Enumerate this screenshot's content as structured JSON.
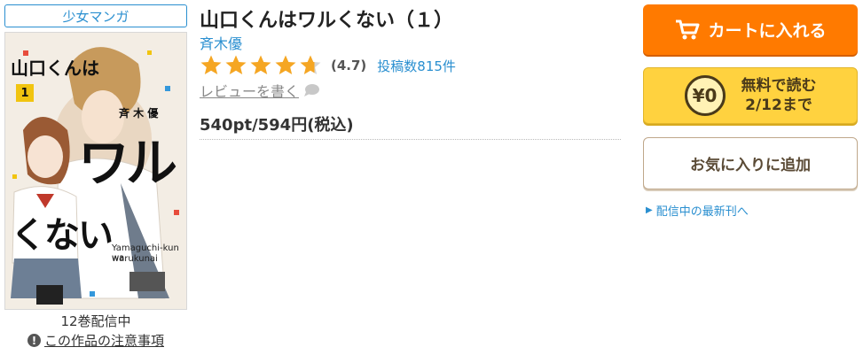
{
  "genre": "少女マンガ",
  "cover": {
    "title_vertical": "山口くんは",
    "volume_badge": "1",
    "big_title_1": "ワル",
    "big_title_2": "くない",
    "author_small": "斉 木 優",
    "romaji_1": "Yamaguchi-kun wa",
    "romaji_2": "warukunai"
  },
  "volumes_label": "12巻配信中",
  "notice_label": "この作品の注意事項",
  "title": "山口くんはワルくない（１）",
  "author": "斉木優",
  "rating": {
    "stars": 4.7,
    "value_label": "(4.7)",
    "count_label": "投稿数815件",
    "color": "#f5a623"
  },
  "write_review_label": "レビューを書く",
  "price_label": "540pt/594円(税込)",
  "buttons": {
    "cart_label": "カートに入れる",
    "free_coin": "¥0",
    "free_line1": "無料で読む",
    "free_line2": "2/12まで",
    "favorite_label": "お気に入りに追加"
  },
  "latest_link": "配信中の最新刊へ",
  "colors": {
    "accent_blue": "#2a8fd0",
    "cart_orange": "#ff7a00",
    "free_yellow": "#ffd23f"
  },
  "icons": {
    "cart": "cart-icon",
    "notice": "exclamation-circle-icon",
    "review": "speech-bubble-icon",
    "link": "triangle-right-icon"
  }
}
